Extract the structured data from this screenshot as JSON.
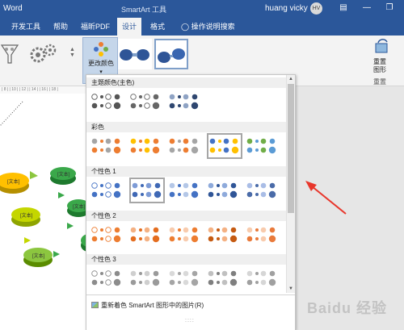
{
  "window": {
    "app_name": "Word",
    "context_title": "SmartArt 工具",
    "user_name": "huang vicky",
    "user_initials": "HV"
  },
  "tabs": {
    "developer": "开发工具",
    "help": "帮助",
    "foxit_pdf": "福昕PDF",
    "design": "设计",
    "format": "格式",
    "tell_me": "操作说明搜索"
  },
  "ribbon": {
    "change_colors": "更改颜色",
    "reset_graphic_1": "重置",
    "reset_graphic_2": "图形",
    "reset_group": "重置"
  },
  "ruler": {
    "text": "| 8 |   | 10 |   | 12 |   | 14 |   | 16 |   | 18 |"
  },
  "gallery": {
    "sections": [
      {
        "title": "主题颜色(主色)"
      },
      {
        "title": "彩色"
      },
      {
        "title": "个性色 1"
      },
      {
        "title": "个性色 2"
      },
      {
        "title": "个性色 3"
      }
    ]
  },
  "footer": {
    "recolor_pictures": "重新着色 SmartArt 图形中的图片(R)"
  },
  "canvas": {
    "node_label": "[文本]"
  },
  "watermark": {
    "text": "Baidu 经验"
  },
  "colors": {
    "accent_blue": "#2b579a",
    "arrow_red": "#e8362b"
  },
  "swatches": [
    {
      "dark": "#555555",
      "light": "#ffffff",
      "outline": true
    },
    {
      "dark": "#666666",
      "light": "#ffffff",
      "outline": true
    },
    {
      "dark": "#2f4770",
      "light": "#8fa3c4",
      "outline": false
    },
    {
      "dark": "#ed7d31",
      "light": "#a5a5a5",
      "outline": false
    },
    {
      "dark": "#ed7d31",
      "light": "#ffc000",
      "outline": false
    },
    {
      "dark": "#a5a5a5",
      "light": "#ed7d31",
      "outline": false
    },
    {
      "dark": "#ffc000",
      "light": "#4472c4",
      "outline": false
    },
    {
      "dark": "#5b9bd5",
      "light": "#70ad47",
      "outline": false
    },
    {
      "dark": "#4472c4",
      "light": "#9db3e0",
      "outline": true
    },
    {
      "dark": "#3f68b5",
      "light": "#7d9bd6",
      "outline": false
    },
    {
      "dark": "#4472c4",
      "light": "#b4c7e7",
      "outline": false
    },
    {
      "dark": "#2f5597",
      "light": "#8eaadb",
      "outline": false
    },
    {
      "dark": "#4a6ba8",
      "light": "#a9bde6",
      "outline": false
    },
    {
      "dark": "#ed7d31",
      "light": "#f4b183",
      "outline": true
    },
    {
      "dark": "#e46d1f",
      "light": "#f4b183",
      "outline": false
    },
    {
      "dark": "#ed7d31",
      "light": "#f8cbad",
      "outline": false
    },
    {
      "dark": "#c55a11",
      "light": "#f4b183",
      "outline": false
    },
    {
      "dark": "#e97a3b",
      "light": "#f8cbad",
      "outline": false
    },
    {
      "dark": "#8c8c8c",
      "light": "#d0d0d0",
      "outline": true
    },
    {
      "dark": "#9a9a9a",
      "light": "#cfcfcf",
      "outline": false
    },
    {
      "dark": "#a5a5a5",
      "light": "#d9d9d9",
      "outline": false
    },
    {
      "dark": "#7f7f7f",
      "light": "#c0c0c0",
      "outline": false
    },
    {
      "dark": "#a0a0a0",
      "light": "#d6d6d6",
      "outline": false
    }
  ]
}
